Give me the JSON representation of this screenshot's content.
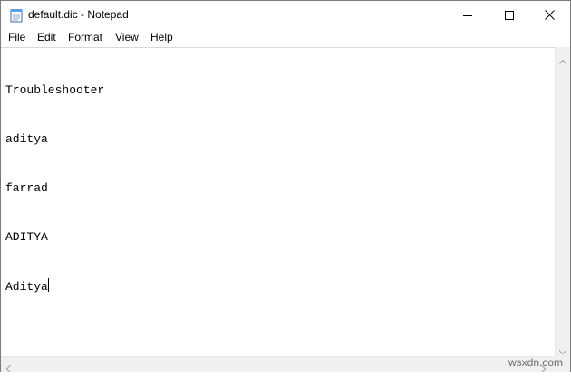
{
  "window": {
    "title": "default.dic - Notepad",
    "app_icon": "notepad-icon",
    "controls": {
      "minimize": "minimize-icon",
      "maximize": "maximize-icon",
      "close": "close-icon"
    }
  },
  "menu": {
    "file": "File",
    "edit": "Edit",
    "format": "Format",
    "view": "View",
    "help": "Help"
  },
  "editor": {
    "lines": [
      "Troubleshooter",
      "aditya",
      "farrad",
      "ADITYA",
      "Aditya"
    ]
  },
  "watermark": "wsxdn.com"
}
